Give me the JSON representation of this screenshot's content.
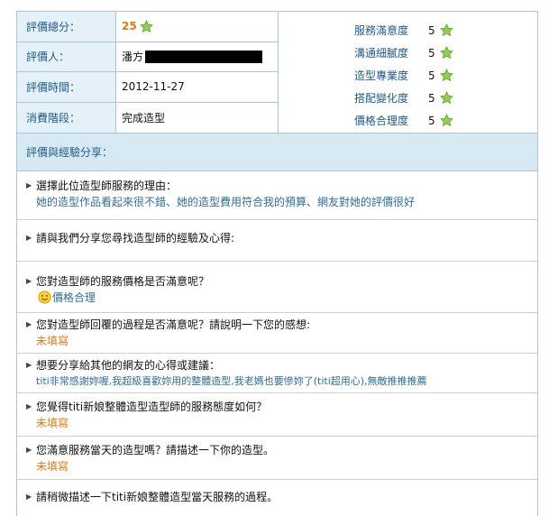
{
  "summary": {
    "rows": [
      {
        "label": "評價總分：",
        "value": "25"
      },
      {
        "label": "評價人：",
        "value": "潘方"
      },
      {
        "label": "評價時間：",
        "value": "2012-11-27"
      },
      {
        "label": "消費階段：",
        "value": "完成造型"
      }
    ],
    "criteria": [
      {
        "label": "服務滿意度",
        "score": "5"
      },
      {
        "label": "溝通細膩度",
        "score": "5"
      },
      {
        "label": "造型專業度",
        "score": "5"
      },
      {
        "label": "搭配變化度",
        "score": "5"
      },
      {
        "label": "價格合理度",
        "score": "5"
      }
    ]
  },
  "section_header": "評價與經驗分享：",
  "qa": [
    {
      "q": "選擇此位造型師服務的理由：",
      "a": "她的造型作品看起來很不錯、她的造型費用符合我的預算、網友對她的評價很好",
      "style": "blue"
    },
    {
      "q": "請與我們分享您尋找造型師的經驗及心得:",
      "a": "",
      "style": "blue"
    },
    {
      "q": "您對造型師的服務價格是否滿意呢？",
      "a": "價格合理",
      "style": "blue",
      "icon": "smiley-icon"
    },
    {
      "q": "您對造型師回覆的過程是否滿意呢？請說明一下您的感想:",
      "a": "未填寫",
      "style": "orange"
    },
    {
      "q": "想要分享給其他的網友的心得或建議：",
      "a": "titi非常感謝妳喔,我超級喜歡妳用的整體造型,我老媽也要慘妳了(titi超用心),無敵推推推薦",
      "style": "blue"
    },
    {
      "q": "您覺得titi新娘整體造型造型師的服務態度如何？",
      "a": "未填寫",
      "style": "orange"
    },
    {
      "q": "您滿意服務當天的造型嗎？請描述一下你的造型。",
      "a": "未填寫",
      "style": "orange"
    },
    {
      "q": "請稍微描述一下titi新娘整體造型當天服務的過程。",
      "a": "",
      "style": "blue"
    }
  ],
  "colors": {
    "accent": "#1f5a8a",
    "header_bg": "#d7eaf3",
    "label_bg": "#e4f1f8",
    "missing": "#e27a10",
    "answer": "#2f6f93",
    "star": "#7cc242"
  }
}
